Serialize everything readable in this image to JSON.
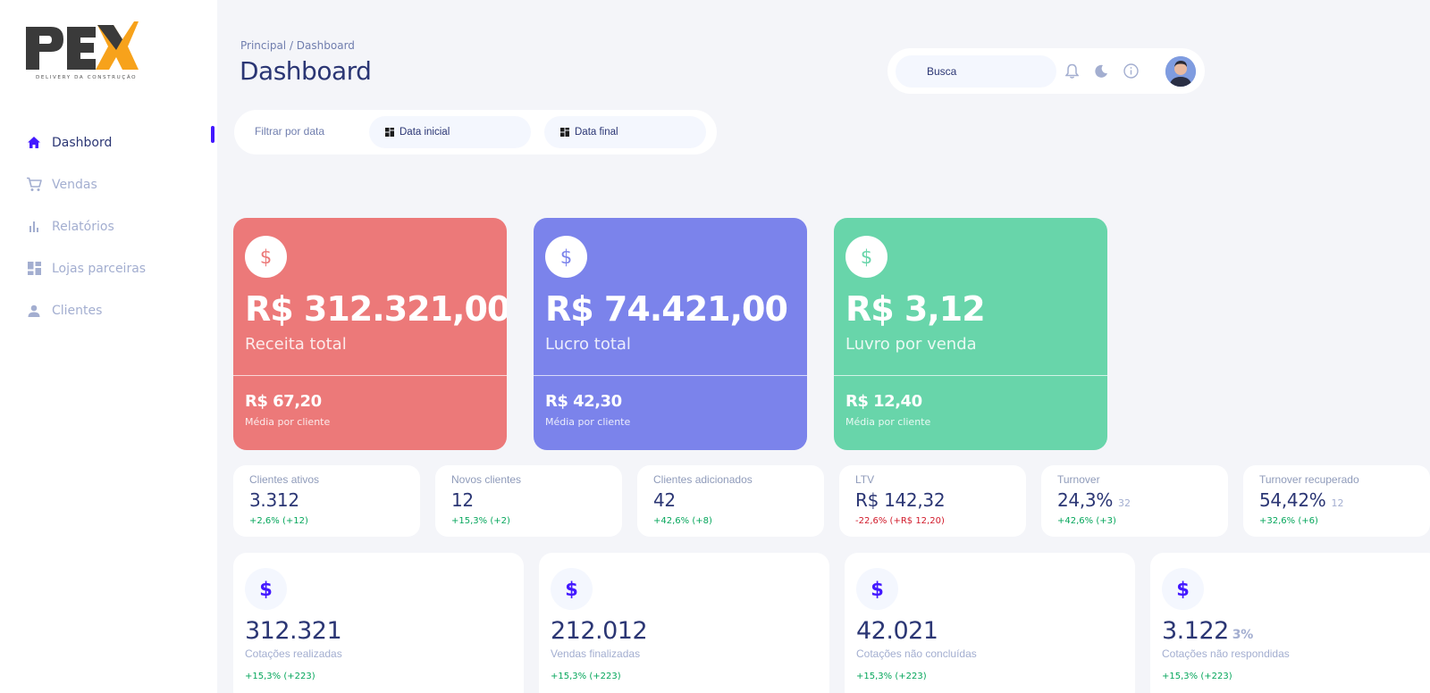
{
  "logo": {
    "text": "PEX",
    "tagline": "DELIVERY DA CONSTRUÇÃO"
  },
  "sidebar": {
    "items": [
      {
        "label": "Dashbord",
        "icon": "home-icon",
        "active": true
      },
      {
        "label": "Vendas",
        "icon": "cart-icon",
        "active": false
      },
      {
        "label": "Relatórios",
        "icon": "bar-chart-icon",
        "active": false
      },
      {
        "label": "Lojas parceiras",
        "icon": "dashboard-grid-icon",
        "active": false
      },
      {
        "label": "Clientes",
        "icon": "person-icon",
        "active": false
      }
    ]
  },
  "header": {
    "breadcrumb": "Principal / Dashboard",
    "title": "Dashboard"
  },
  "topbar": {
    "search_placeholder": "Busca",
    "icons": [
      "bell-icon",
      "moon-icon",
      "info-icon",
      "avatar"
    ]
  },
  "filter": {
    "label": "Filtrar por data",
    "start_label": "Data inicial",
    "end_label": "Data final"
  },
  "big_cards": [
    {
      "amount": "R$ 312.321,00",
      "caption": "Receita total",
      "sub_amount": "R$ 67,20",
      "sub_caption": "Média por cliente",
      "color": "#ec7979",
      "icon": "dollar-icon"
    },
    {
      "amount": "R$ 74.421,00",
      "caption": "Lucro total",
      "sub_amount": "R$ 42,30",
      "sub_caption": "Média por cliente",
      "color": "#7b83eb",
      "icon": "dollar-icon"
    },
    {
      "amount": "R$ 3,12",
      "caption": "Luvro por venda",
      "sub_amount": "R$ 12,40",
      "sub_caption": "Média por cliente",
      "color": "#68d5aa",
      "icon": "dollar-icon"
    }
  ],
  "kpis": [
    {
      "label": "Clientes ativos",
      "value": "3.312",
      "extra": "",
      "delta": "+2,6% (+12)",
      "trend": "positive"
    },
    {
      "label": "Novos clientes",
      "value": "12",
      "extra": "",
      "delta": "+15,3% (+2)",
      "trend": "positive"
    },
    {
      "label": "Clientes adicionados",
      "value": "42",
      "extra": "",
      "delta": "+42,6% (+8)",
      "trend": "positive"
    },
    {
      "label": "LTV",
      "value": "R$ 142,32",
      "extra": "",
      "delta": "-22,6% (+R$ 12,20)",
      "trend": "negative"
    },
    {
      "label": "Turnover",
      "value": "24,3%",
      "extra": "32",
      "delta": "+42,6% (+3)",
      "trend": "positive"
    },
    {
      "label": "Turnover recuperado",
      "value": "54,42%",
      "extra": "12",
      "delta": "+32,6% (+6)",
      "trend": "positive"
    }
  ],
  "stats": [
    {
      "value": "312.321",
      "extra": "",
      "label": "Cotações realizadas",
      "delta": "+15,3% (+223)"
    },
    {
      "value": "212.012",
      "extra": "",
      "label": "Vendas finalizadas",
      "delta": "+15,3% (+223)"
    },
    {
      "value": "42.021",
      "extra": "",
      "label": "Cotações não concluídas",
      "delta": "+15,3% (+223)"
    },
    {
      "value": "3.122",
      "extra": "3%",
      "label": "Cotações não respondidas",
      "delta": "+15,3% (+223)"
    }
  ],
  "colors": {
    "accent": "#4318ff",
    "navy": "#2b3674",
    "muted": "#a3aed0",
    "positive": "#05a65b",
    "negative": "#d11a2a"
  }
}
